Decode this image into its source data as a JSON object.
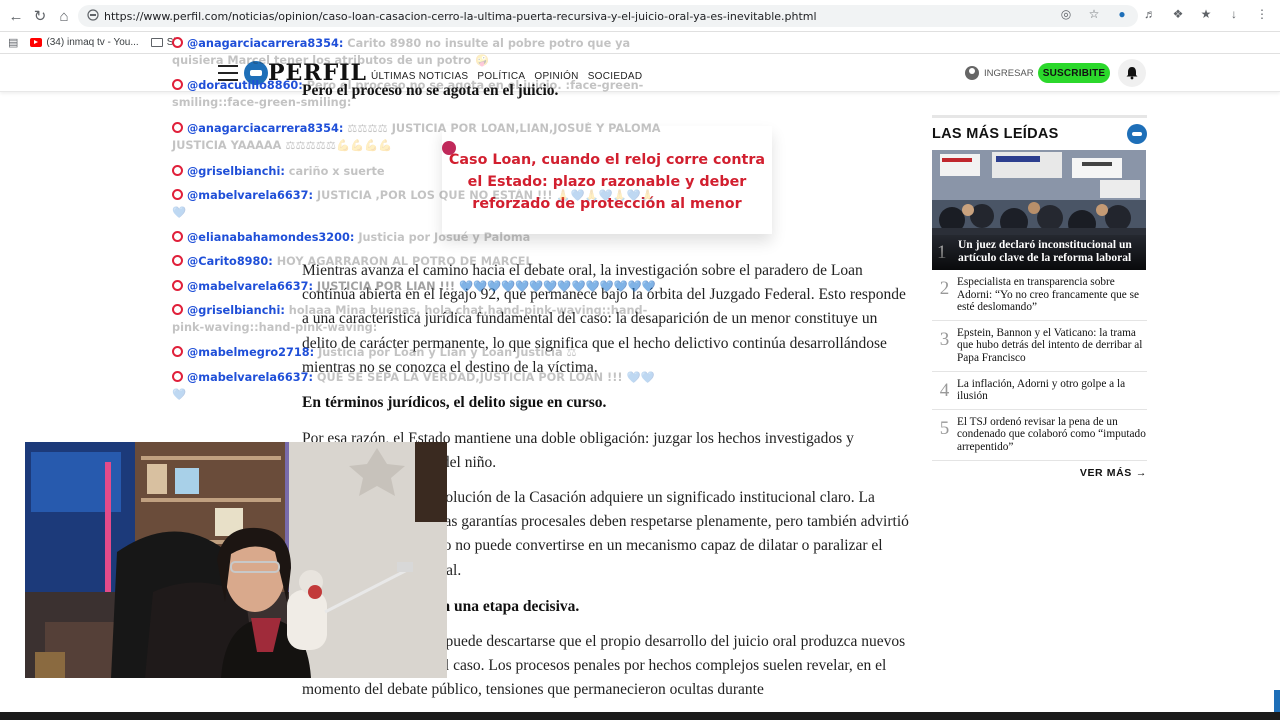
{
  "browser": {
    "url": "https://www.perfil.com/noticias/opinion/caso-loan-casacion-cerro-la-ultima-puerta-recursiva-y-el-juicio-oral-ya-es-inevitable.phtml",
    "bookmarks": [
      "(34) inmaq tv - You...",
      "Sh"
    ]
  },
  "site": {
    "logo": "PERFIL",
    "nav": [
      "ÚLTIMAS NOTICIAS",
      "POLÍTICA",
      "OPINIÓN",
      "SOCIEDAD"
    ],
    "login": "INGRESAR",
    "subscribe": "SUSCRIBITE"
  },
  "article": {
    "heading1": "Pero el proceso no se agota en el juicio.",
    "para1": "Mientras avanza el camino hacia el debate oral, la investigación sobre el paradero de Loan continúa abierta en el legajo 92, que permanece bajo la órbita del Juzgado Federal. Esto responde a una característica jurídica fundamental del caso: la desaparición de un menor constituye un delito de carácter permanente, lo que significa que el hecho delictivo continúa desarrollándose mientras no se conozca el destino de la víctima.",
    "heading2": "En términos jurídicos, el delito sigue en curso.",
    "para2": "Por esa razón, el Estado mantiene una doble obligación: juzgar los hechos investigados y continuar la búsqueda del niño.",
    "para3": "En este contexto, la resolución de la Casación adquiere un significado institucional claro. La Casación sostuvo que las garantías procesales deben respetarse plenamente, pero también advirtió que el sistema recursivo no puede convertirse en un mecanismo capaz de dilatar o paralizar el avance del proceso penal.",
    "heading3": "El caso entra ahora en una etapa decisiva.",
    "para4": "Sin embargo, tampoco puede descartarse que el propio desarrollo del juicio oral produzca nuevos movimientos dentro del caso. Los procesos penales por hechos complejos suelen revelar, en el momento del debate público, tensiones que permanecieron ocultas durante"
  },
  "popup": {
    "text": "Caso Loan, cuando el reloj corre contra el Estado: plazo razonable y deber reforzado de protección al menor"
  },
  "sidebar": {
    "title": "LAS MÁS LEÍDAS",
    "items": [
      {
        "num": "1",
        "text": "Un juez declaró inconstitucional un artículo clave de la reforma laboral"
      },
      {
        "num": "2",
        "text": "Especialista en transparencia sobre Adorni: “Yo no creo francamente que se esté deslomando”"
      },
      {
        "num": "3",
        "text": "Epstein, Bannon y el Vaticano: la trama que hubo detrás del intento de derribar al Papa Francisco"
      },
      {
        "num": "4",
        "text": "La inflación, Adorni y otro golpe a la ilusión"
      },
      {
        "num": "5",
        "text": "El TSJ ordenó revisar la pena de un condenado que colaboró como “imputado arrepentido”"
      }
    ],
    "more": "VER MÁS"
  },
  "chat": [
    {
      "user": "@anagarciacarrera8354",
      "msg": "Carito 8980 no insulte al pobre potro que ya quisiera Marcel tener los atributos de un potro 🤪"
    },
    {
      "user": "@doracutillo8860",
      "msg": "Pero el proceso no se agota en el juicio. :face-green-smiling::face-green-smiling:"
    },
    {
      "user": "@anagarciacarrera8354",
      "msg": "⚖⚖⚖⚖ JUSTICIA POR LOAN,LIAN,JOSUÉ Y PALOMA JUSTICIA YAAAAA ⚖⚖⚖⚖⚖💪💪💪💪"
    },
    {
      "user": "@griselbianchi",
      "msg": "cariño x suerte"
    },
    {
      "user": "@mabelvarela6637",
      "msg": "JUSTICIA ,POR LOS QUE NO ESTÁN !!! 🙏💙🙏💙🙏💙🙏💙"
    },
    {
      "user": "@elianabahamondes3200",
      "msg": "Justicia por Josué y Paloma"
    },
    {
      "user": "@Carito8980",
      "msg": "HOY AGARRARON AL POTRO DE MARCEL"
    },
    {
      "user": "@mabelvarela6637",
      "msg": "JUSTICIA POR LIAN !!! 💙💙💙💙💙💙💙💙💙💙💙💙💙💙"
    },
    {
      "user": "@griselbianchi",
      "msg": "holaaa Mina buenas, hola chat,hand-pink-waving::hand-pink-waving::hand-pink-waving:"
    },
    {
      "user": "@mabelmegro2718",
      "msg": "Justicia por Loan y Lian y Loan Justicia ⚖"
    },
    {
      "user": "@mabelvarela6637",
      "msg": "QUE SE SEPA LA VERDAD,JUSTICIA POR LOAN !!! 💙💙💙"
    }
  ],
  "colors": {
    "accent_blue": "#1e6fb8",
    "subscribe_green": "#2bd82b",
    "popup_red": "#d21f2f",
    "chat_user_blue": "#1f4fd8"
  }
}
